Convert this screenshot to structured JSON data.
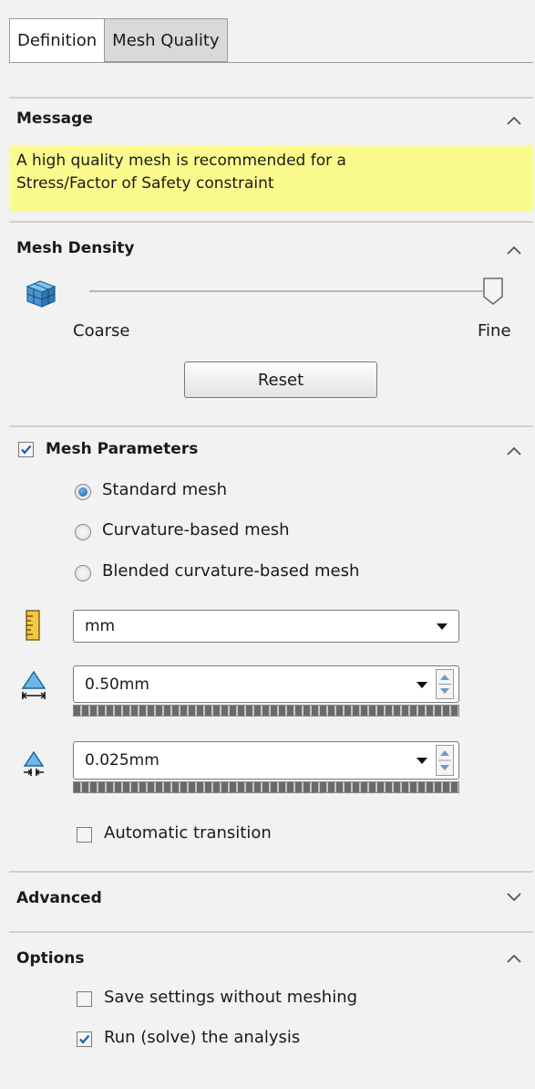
{
  "tabs": [
    {
      "label": "Definition",
      "active": true
    },
    {
      "label": "Mesh Quality",
      "active": false
    }
  ],
  "message": {
    "title": "Message",
    "text_line1": "A high quality mesh is recommended for a",
    "text_line2": "Stress/Factor of Safety constraint",
    "highlight_color": "#fbfb8d"
  },
  "mesh_density": {
    "title": "Mesh Density",
    "icon": "mesh-cube-icon",
    "slider_position": 1.0,
    "coarse_label": "Coarse",
    "fine_label": "Fine",
    "reset_label": "Reset"
  },
  "mesh_parameters": {
    "title": "Mesh Parameters",
    "checked": true,
    "options": [
      {
        "label": "Standard mesh",
        "selected": true
      },
      {
        "label": "Curvature-based mesh",
        "selected": false
      },
      {
        "label": "Blended curvature-based mesh",
        "selected": false
      }
    ],
    "unit_icon": "ruler-icon",
    "unit_value": "mm",
    "element_size_icon": "element-size-icon",
    "element_size": "0.50mm",
    "tolerance_icon": "tolerance-icon",
    "tolerance": "0.025mm",
    "auto_transition_label": "Automatic transition",
    "auto_transition_checked": false
  },
  "advanced": {
    "title": "Advanced",
    "collapsed": true
  },
  "options": {
    "title": "Options",
    "save_without_meshing_label": "Save settings without meshing",
    "save_without_meshing_checked": false,
    "run_analysis_label": "Run (solve) the analysis",
    "run_analysis_checked": true
  },
  "colors": {
    "accent": "#1a5fa8",
    "panel_bg": "#f2f2f2",
    "divider": "#d0d0d0"
  }
}
